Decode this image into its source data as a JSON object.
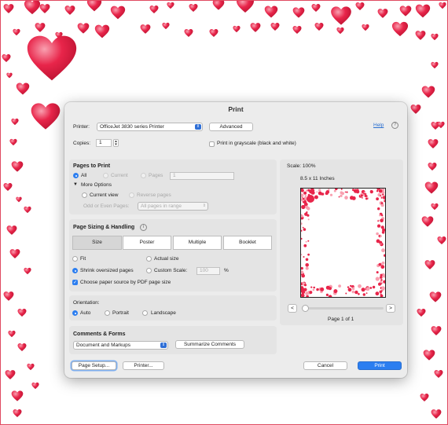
{
  "dialog": {
    "title": "Print",
    "printer_label": "Printer:",
    "printer_value": "OfficeJet 3830 series Printer",
    "advanced_label": "Advanced",
    "help_label": "Help",
    "copies_label": "Copies:",
    "copies_value": "1",
    "grayscale_label": "Print in grayscale (black and white)",
    "grayscale_checked": false
  },
  "pages_to_print": {
    "title": "Pages to Print",
    "all_label": "All",
    "current_label": "Current",
    "pages_label": "Pages",
    "pages_value": "1",
    "more_options_label": "More Options",
    "current_view_label": "Current view",
    "reverse_pages_label": "Reverse pages",
    "odd_even_label": "Odd or Even Pages:",
    "odd_even_value": "All pages in range"
  },
  "sizing": {
    "title": "Page Sizing & Handling",
    "tabs": [
      "Size",
      "Poster",
      "Multiple",
      "Booklet"
    ],
    "selected_tab": "Size",
    "fit_label": "Fit",
    "actual_size_label": "Actual size",
    "shrink_label": "Shrink oversized pages",
    "custom_scale_label": "Custom Scale:",
    "custom_scale_value": "100",
    "percent_sign": "%",
    "choose_paper_label": "Choose paper source by PDF page size",
    "choose_paper_checked": true
  },
  "orientation": {
    "title": "Orientation:",
    "auto_label": "Auto",
    "portrait_label": "Portrait",
    "landscape_label": "Landscape",
    "selected": "Auto"
  },
  "comments_forms": {
    "title": "Comments & Forms",
    "value": "Document and Markups",
    "summarize_label": "Summarize Comments"
  },
  "preview": {
    "scale_label": "Scale: 100%",
    "paper_size": "8.5 x 11 Inches",
    "prev_label": "<",
    "next_label": ">",
    "page_indicator": "Page 1 of 1",
    "slider_position": 0
  },
  "footer": {
    "page_setup_label": "Page Setup...",
    "printer_label": "Printer...",
    "cancel_label": "Cancel",
    "print_label": "Print"
  },
  "colors": {
    "accent": "#2c7ef0",
    "heart": "#e8254a",
    "heart_light": "#f9a0b0"
  }
}
